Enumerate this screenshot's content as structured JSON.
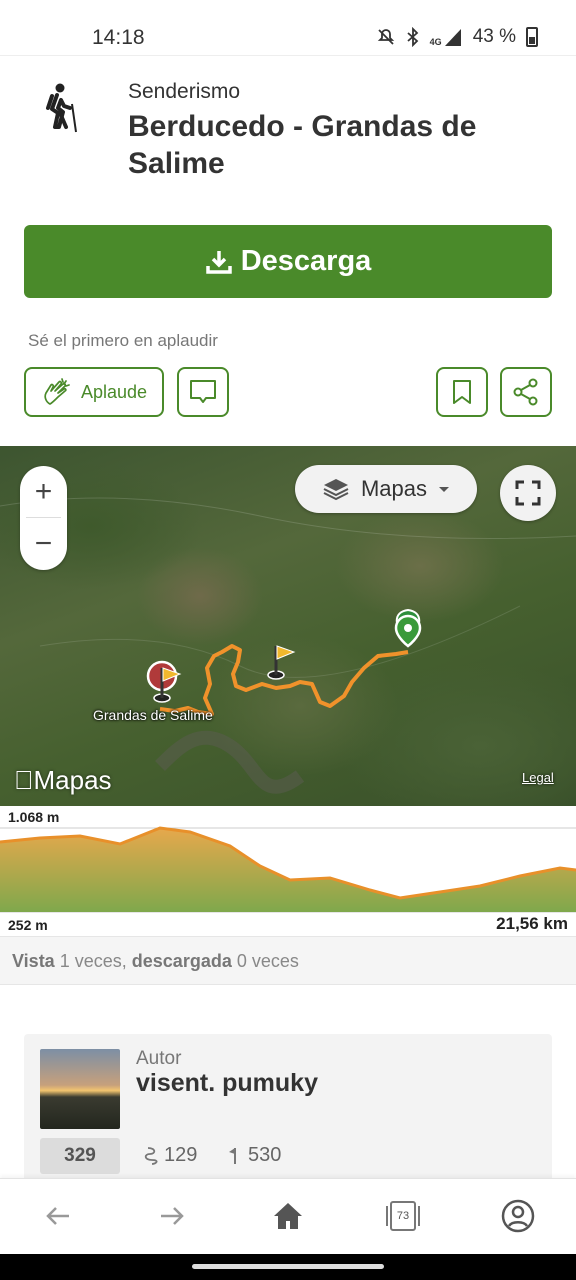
{
  "status_bar": {
    "time": "14:18",
    "network": "4G",
    "battery": "43 %"
  },
  "header": {
    "activity_icon": "hiker-icon",
    "activity": "Senderismo",
    "title": "Berducedo - Grandas de Salime"
  },
  "download": {
    "label": "Descarga",
    "icon": "download-icon",
    "color": "#4a8a2a"
  },
  "social": {
    "prompt": "Sé el primero en aplaudir",
    "clap_label": "Aplaude",
    "clap_icon": "clap-icon",
    "comment_icon": "comment-icon",
    "bookmark_icon": "bookmark-icon",
    "share_icon": "share-icon"
  },
  "map": {
    "zoom_in": "+",
    "zoom_out": "−",
    "layer_label": "Mapas",
    "town_label": "Grandas de Salime",
    "brand": "Mapas",
    "legal": "Legal",
    "route_color": "#f0922b"
  },
  "elevation": {
    "max": "1.068 m",
    "min": "252 m",
    "distance": "21,56 km"
  },
  "stats": {
    "views_label": "Vista",
    "views_text": "1 veces,",
    "downloads_label": "descargada",
    "downloads_text": "0 veces"
  },
  "author": {
    "label": "Autor",
    "name": "visent. pumuky",
    "score": "329",
    "trails": "129",
    "followers": "530"
  },
  "bottom_nav": {
    "back_icon": "back-arrow-icon",
    "forward_icon": "forward-arrow-icon",
    "home_icon": "home-icon",
    "tabs_count": "73",
    "profile_icon": "profile-icon"
  }
}
